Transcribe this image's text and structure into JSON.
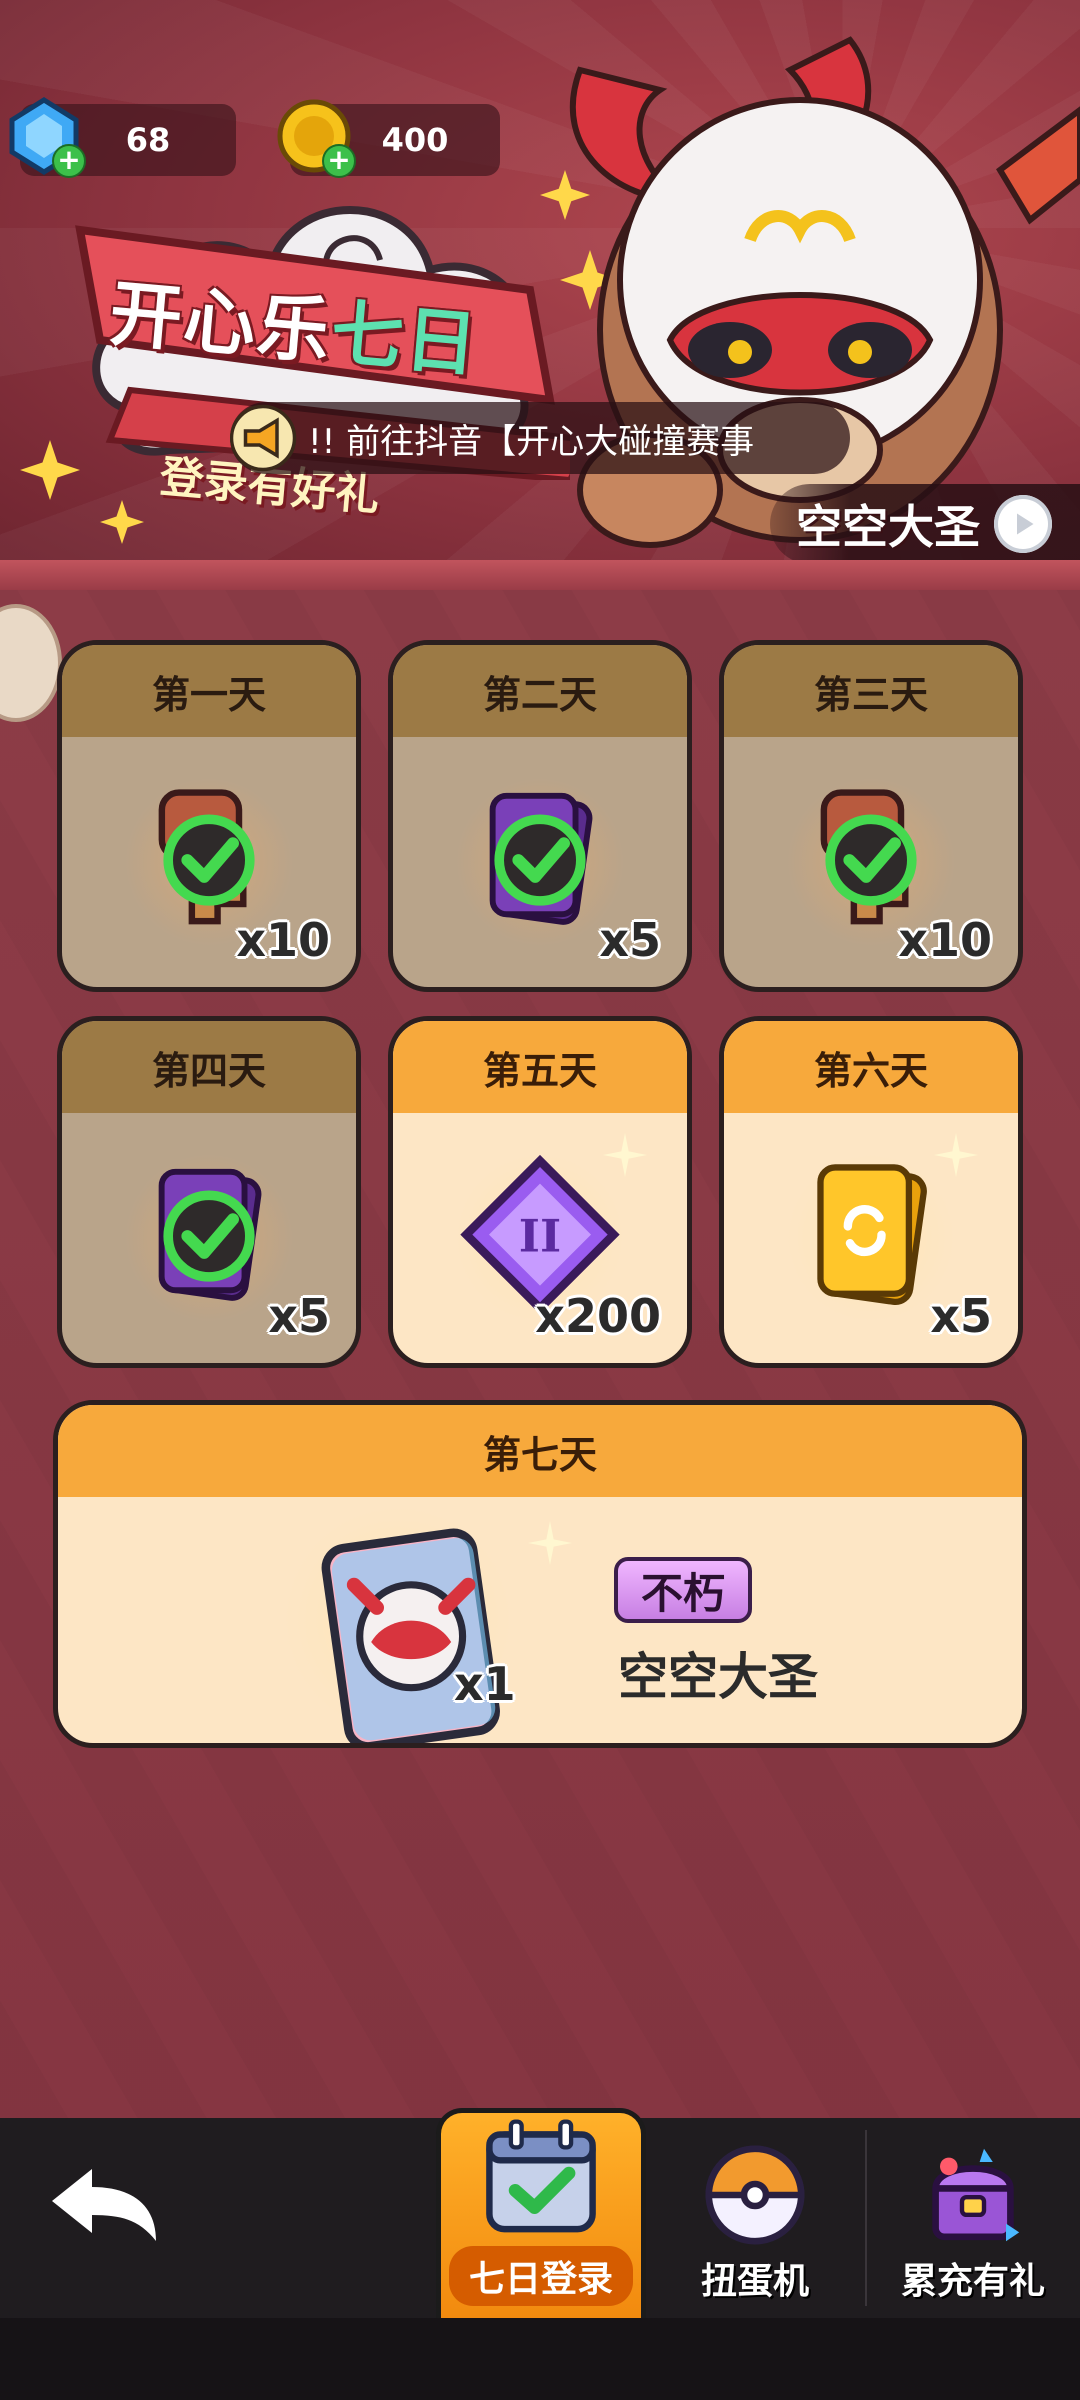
{
  "currencies": [
    {
      "name": "gem",
      "value": "68"
    },
    {
      "name": "coin",
      "value": "400"
    }
  ],
  "banner": {
    "title_part1": "开心乐",
    "title_part2": "七日",
    "subtitle": "登录有好礼",
    "notice_text": "!! 前往抖音【开心大碰撞赛事",
    "hero_button_label": "空空大圣"
  },
  "days": [
    {
      "label": "第一天",
      "qty": "x10",
      "item": "key-icon",
      "state": "claimed"
    },
    {
      "label": "第二天",
      "qty": "x5",
      "item": "purple-card-icon",
      "state": "claimed"
    },
    {
      "label": "第三天",
      "qty": "x10",
      "item": "key-icon",
      "state": "claimed"
    },
    {
      "label": "第四天",
      "qty": "x5",
      "item": "purple-card-icon",
      "state": "claimed"
    },
    {
      "label": "第五天",
      "qty": "x200",
      "item": "crystal-icon",
      "state": "open"
    },
    {
      "label": "第六天",
      "qty": "x5",
      "item": "gold-refresh-card-icon",
      "state": "open"
    }
  ],
  "day7": {
    "label": "第七天",
    "qty": "x1",
    "rarity": "不朽",
    "hero_name": "空空大圣"
  },
  "nav": {
    "tabs": [
      {
        "label": "七日登录",
        "active": true
      },
      {
        "label": "扭蛋机",
        "active": false
      },
      {
        "label": "累充有礼",
        "active": false
      }
    ]
  },
  "colors": {
    "claimed_card": "#b9a48a",
    "claimed_header": "#9c7a45",
    "open_card": "#fde6c5",
    "open_header": "#f7a93c",
    "check_green": "#44d94f",
    "background": "#8a3b46"
  }
}
